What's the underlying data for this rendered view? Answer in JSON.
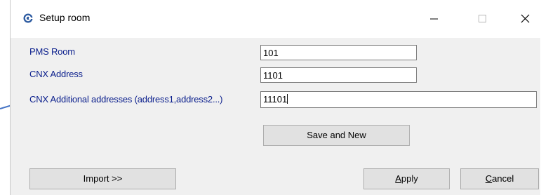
{
  "window": {
    "title": "Setup room",
    "icon": "app-gear-icon",
    "controls": [
      "minimize-icon",
      "maximize-icon",
      "close-icon"
    ]
  },
  "form": {
    "pms_room": {
      "label": "PMS Room",
      "value": "101"
    },
    "cnx_address": {
      "label": "CNX Address",
      "value": "1101"
    },
    "cnx_additional": {
      "label": "CNX Additional addresses (address1,address2...)",
      "value": "11101"
    }
  },
  "buttons": {
    "save_new": "Save and New",
    "import": "Import >>",
    "apply_mnemonic": "A",
    "apply_rest": "pply",
    "cancel_mnemonic": "C",
    "cancel_rest": "ancel"
  },
  "colors": {
    "label": "#0a1e8c",
    "arrow": "#4472c4",
    "dialog_bg": "#f0f0f0"
  }
}
